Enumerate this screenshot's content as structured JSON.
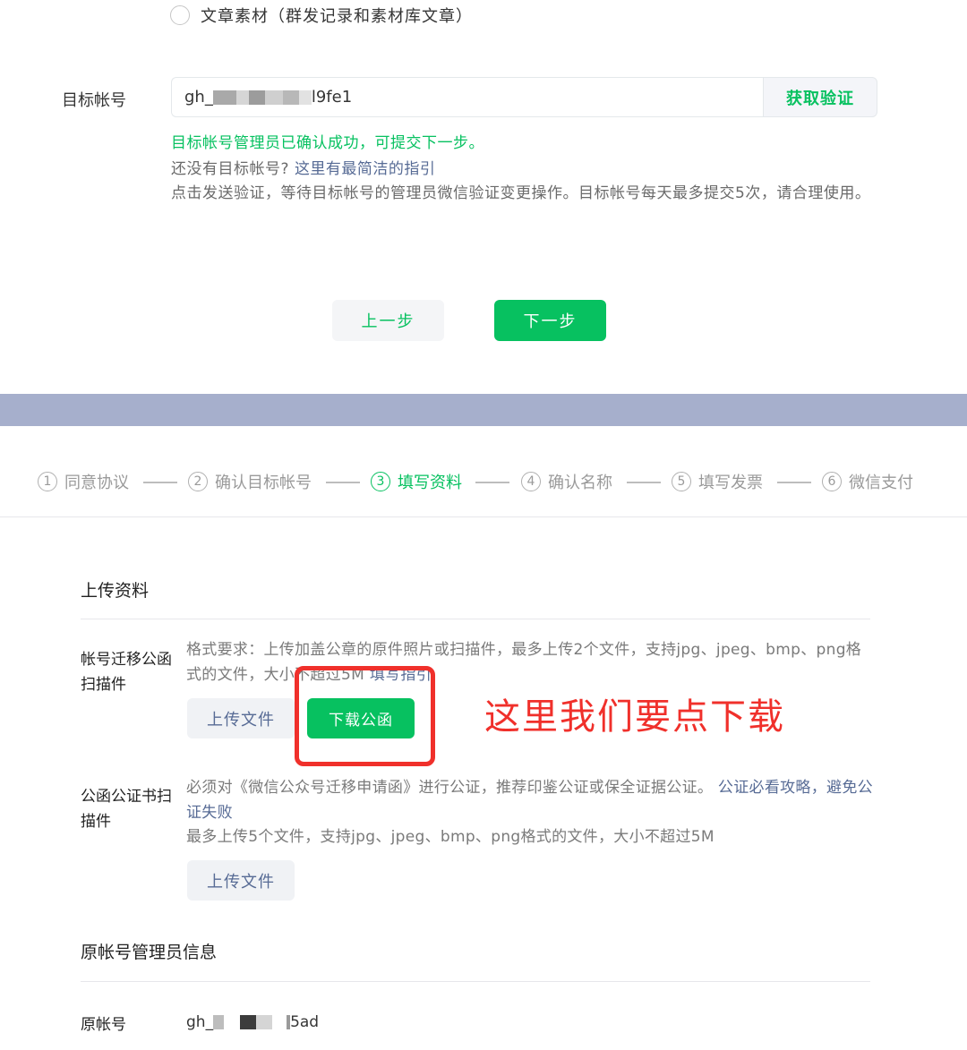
{
  "top": {
    "radio_label": "文章素材（群发记录和素材库文章）",
    "target_label": "目标帐号",
    "account_prefix": "gh_",
    "account_suffix": "l9fe1",
    "get_verify_label": "获取验证",
    "success_msg": "目标帐号管理员已确认成功，可提交下一步。",
    "no_account_q": "还没有目标帐号?",
    "guide_link": "这里有最简洁的指引",
    "desc": "点击发送验证，等待目标帐号的管理员微信验证变更操作。目标帐号每天最多提交5次，请合理使用。",
    "prev_label": "上一步",
    "next_label": "下一步"
  },
  "stepper": {
    "steps": [
      {
        "num": "1",
        "label": "同意协议"
      },
      {
        "num": "2",
        "label": "确认目标帐号"
      },
      {
        "num": "3",
        "label": "填写资料"
      },
      {
        "num": "4",
        "label": "确认名称"
      },
      {
        "num": "5",
        "label": "填写发票"
      },
      {
        "num": "6",
        "label": "微信支付"
      }
    ],
    "active_index": 2
  },
  "upload": {
    "title": "上传资料",
    "row1_label": "帐号迁移公函扫描件",
    "row1_req": "格式要求：上传加盖公章的原件照片或扫描件，最多上传2个文件，支持jpg、jpeg、bmp、png格式的文件，大小不超过5M",
    "row1_req_link": "填写指引",
    "upload_label": "上传文件",
    "download_label": "下载公函",
    "annotation": "这里我们要点下载",
    "row2_label": "公函公证书扫描件",
    "row2_req_a": "必须对《微信公众号迁移申请函》进行公证，推荐印鉴公证或保全证据公证。",
    "row2_link": "公证必看攻略，避免公证失败",
    "row2_req_b": "最多上传5个文件，支持jpg、jpeg、bmp、png格式的文件，大小不超过5M"
  },
  "admin": {
    "title": "原帐号管理员信息",
    "orig_label": "原帐号",
    "orig_prefix": "gh_",
    "orig_suffix": "5ad"
  },
  "colors": {
    "brand_green": "#07c160",
    "link_blue": "#576b95",
    "annotation_red": "#f0302b",
    "band": "#a6afcc"
  }
}
